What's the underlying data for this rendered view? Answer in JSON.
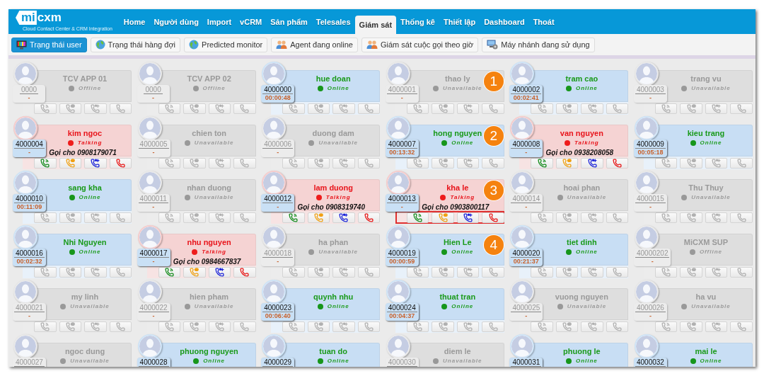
{
  "logo": {
    "part_a": "mi",
    "part_b": "cxm",
    "tagline": "Cloud Contact Center & CRM Integration"
  },
  "nav": [
    {
      "label": "Home",
      "selected": false
    },
    {
      "label": "Người dùng",
      "selected": false
    },
    {
      "label": "Import",
      "selected": false
    },
    {
      "label": "vCRM",
      "selected": false
    },
    {
      "label": "Sản phẩm",
      "selected": false
    },
    {
      "label": "Telesales",
      "selected": false
    },
    {
      "label": "Giám sát",
      "selected": true
    },
    {
      "label": "Thống kê",
      "selected": false
    },
    {
      "label": "Thiết lập",
      "selected": false
    },
    {
      "label": "Dashboard",
      "selected": false
    },
    {
      "label": "Thoát",
      "selected": false
    }
  ],
  "toolbar": [
    {
      "label": "Trạng thái user",
      "selected": true
    },
    {
      "label": "Trạng thái hàng đợi",
      "selected": false
    },
    {
      "label": "Predicted monitor",
      "selected": false
    },
    {
      "label": "Agent đang online",
      "selected": false
    },
    {
      "label": "Giám sát cuộc gọi theo giờ",
      "selected": false
    },
    {
      "label": "Máy nhánh đang sử dụng",
      "selected": false
    }
  ],
  "agents": [
    {
      "name": "TCV APP 01",
      "ext": "0000",
      "status": "Offline",
      "kind": "offline",
      "time": "-"
    },
    {
      "name": "TCV APP 02",
      "ext": "0000",
      "status": "Offline",
      "kind": "offline",
      "time": "-"
    },
    {
      "name": "hue doan",
      "ext": "4000000",
      "status": "Online",
      "kind": "online",
      "time": "00:00:48"
    },
    {
      "name": "thao ly",
      "ext": "4000001",
      "status": "Unavailable",
      "kind": "unavailable",
      "time": "-",
      "marker": "1"
    },
    {
      "name": "tram cao",
      "ext": "4000002",
      "status": "Online",
      "kind": "online",
      "time": "00:02:41"
    },
    {
      "name": "trang vu",
      "ext": "4000003",
      "status": "Unavailable",
      "kind": "unavailable",
      "time": "-"
    },
    {
      "name": "kim ngoc",
      "ext": "4000004",
      "status": "Talking",
      "kind": "talking",
      "time": "-",
      "call": "Gọi cho 0908179071"
    },
    {
      "name": "chien ton",
      "ext": "4000005",
      "status": "Unavailable",
      "kind": "unavailable",
      "time": "-"
    },
    {
      "name": "duong dam",
      "ext": "4000006",
      "status": "Unavailable",
      "kind": "unavailable",
      "time": "-"
    },
    {
      "name": "hong nguyen",
      "ext": "4000007",
      "status": "Online",
      "kind": "online",
      "time": "00:13:32",
      "marker": "2"
    },
    {
      "name": "van nguyen",
      "ext": "4000008",
      "status": "Talking",
      "kind": "talking",
      "time": "-",
      "call": "Gọi cho 0938208058"
    },
    {
      "name": "kieu trang",
      "ext": "4000009",
      "status": "Online",
      "kind": "online",
      "time": "00:05:18"
    },
    {
      "name": "sang kha",
      "ext": "4000010",
      "status": "Online",
      "kind": "online",
      "time": "00:11:09"
    },
    {
      "name": "nhan duong",
      "ext": "4000011",
      "status": "Unavailable",
      "kind": "unavailable",
      "time": "-"
    },
    {
      "name": "lam duong",
      "ext": "4000012",
      "status": "Talking",
      "kind": "talking",
      "time": "-",
      "call": "Gọi cho 0908319740"
    },
    {
      "name": "kha le",
      "ext": "4000013",
      "status": "Talking",
      "kind": "talking",
      "time": "-",
      "call": "Gọi cho 0903800117",
      "marker": "3",
      "highlighted": true
    },
    {
      "name": "hoai phan",
      "ext": "4000014",
      "status": "Unavailable",
      "kind": "unavailable",
      "time": "-"
    },
    {
      "name": "Thu Thuy",
      "ext": "4000015",
      "status": "Unavailable",
      "kind": "unavailable",
      "time": "-"
    },
    {
      "name": "Nhi Nguyen",
      "ext": "4000016",
      "status": "Online",
      "kind": "online",
      "time": "00:02:32"
    },
    {
      "name": "nhu nguyen",
      "ext": "4000017",
      "status": "Talking",
      "kind": "talking",
      "time": "-",
      "call": "Gọi cho 0984667837"
    },
    {
      "name": "ha phan",
      "ext": "4000018",
      "status": "Unavailable",
      "kind": "unavailable",
      "time": "-"
    },
    {
      "name": "Hien Le",
      "ext": "4000019",
      "status": "Online",
      "kind": "online",
      "time": "00:00:59",
      "marker": "4"
    },
    {
      "name": "tiet dinh",
      "ext": "4000020",
      "status": "Online",
      "kind": "online",
      "time": "00:21:37"
    },
    {
      "name": "MiCXM SUP",
      "ext": "40000202",
      "status": "Offline",
      "kind": "offline",
      "time": "-"
    },
    {
      "name": "my linh",
      "ext": "4000021",
      "status": "Unavailable",
      "kind": "unavailable",
      "time": "-"
    },
    {
      "name": "hien pham",
      "ext": "4000022",
      "status": "Unavailable",
      "kind": "unavailable",
      "time": "-"
    },
    {
      "name": "quynh nhu",
      "ext": "4000023",
      "status": "Online",
      "kind": "online",
      "time": "00:06:40"
    },
    {
      "name": "thuat tran",
      "ext": "4000024",
      "status": "Online",
      "kind": "online",
      "time": "00:04:37"
    },
    {
      "name": "vuong nguyen",
      "ext": "4000025",
      "status": "Unavailable",
      "kind": "unavailable",
      "time": "-"
    },
    {
      "name": "ha vu",
      "ext": "4000026",
      "status": "Unavailable",
      "kind": "unavailable",
      "time": "-"
    },
    {
      "name": "ngoc dung",
      "ext": "4000027",
      "status": "Unavailable",
      "kind": "unavailable"
    },
    {
      "name": "phuong nguyen",
      "ext": "4000028",
      "status": "Online",
      "kind": "online"
    },
    {
      "name": "tuan do",
      "ext": "4000029",
      "status": "Online",
      "kind": "online"
    },
    {
      "name": "diem le",
      "ext": "4000030",
      "status": "Unavailable",
      "kind": "unavailable"
    },
    {
      "name": "phuong le",
      "ext": "4000031",
      "status": "Online",
      "kind": "online"
    },
    {
      "name": "mai le",
      "ext": "4000032",
      "status": "Online",
      "kind": "online"
    }
  ]
}
